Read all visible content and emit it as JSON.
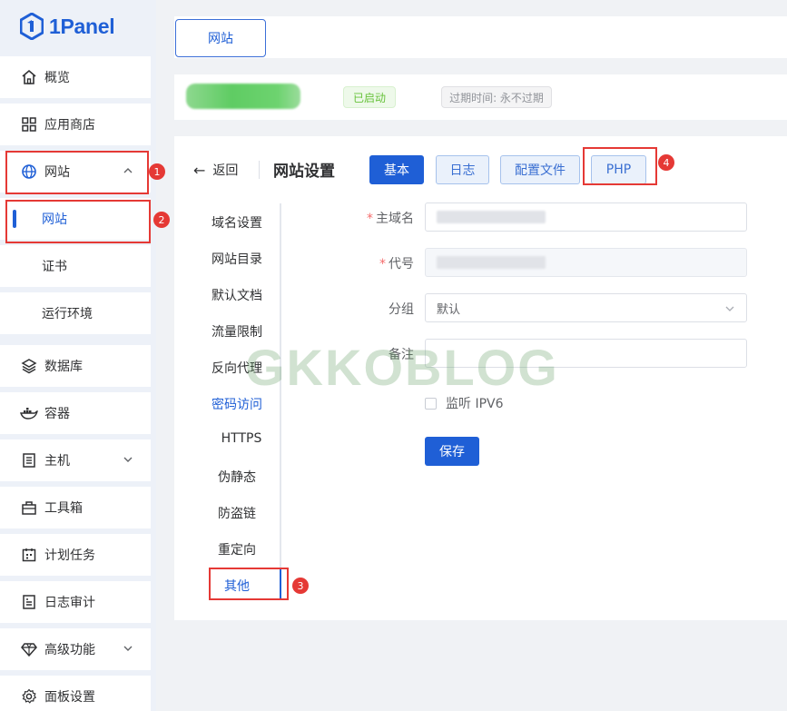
{
  "app": {
    "brand": "1Panel"
  },
  "sidebar": {
    "items": [
      {
        "label": "概览",
        "icon": "home-icon"
      },
      {
        "label": "应用商店",
        "icon": "grid-icon"
      },
      {
        "label": "网站",
        "icon": "globe-icon",
        "expanded": true
      },
      {
        "label": "网站",
        "sub": true,
        "active": true
      },
      {
        "label": "证书",
        "sub": true
      },
      {
        "label": "运行环境",
        "sub": true
      },
      {
        "label": "数据库",
        "icon": "layers-icon"
      },
      {
        "label": "容器",
        "icon": "docker-icon"
      },
      {
        "label": "主机",
        "icon": "server-icon",
        "has_caret": true
      },
      {
        "label": "工具箱",
        "icon": "toolbox-icon"
      },
      {
        "label": "计划任务",
        "icon": "calendar-icon"
      },
      {
        "label": "日志审计",
        "icon": "log-icon"
      },
      {
        "label": "高级功能",
        "icon": "diamond-icon",
        "has_caret": true
      },
      {
        "label": "面板设置",
        "icon": "gear-icon"
      }
    ]
  },
  "header": {
    "tab_label": "网站"
  },
  "site_info": {
    "status": "已启动",
    "expiry": "过期时间: 永不过期"
  },
  "settings": {
    "back_label": "返回",
    "title": "网站设置",
    "tabs": [
      "基本",
      "日志",
      "配置文件",
      "PHP"
    ],
    "active_tab": "基本",
    "menu": [
      "域名设置",
      "网站目录",
      "默认文档",
      "流量限制",
      "反向代理",
      "密码访问",
      "HTTPS",
      "伪静态",
      "防盗链",
      "重定向",
      "其他"
    ],
    "active_menu": "其他",
    "form": {
      "primary_domain_label": "主域名",
      "code_label": "代号",
      "group_label": "分组",
      "group_value": "默认",
      "remark_label": "备注",
      "ipv6_label": "监听 IPV6",
      "save_label": "保存"
    }
  },
  "watermark": "GKKOBLOG",
  "annotations": [
    "1",
    "2",
    "3",
    "4"
  ],
  "colors": {
    "accent": "#1f5fd6",
    "success": "#67c23a",
    "highlight": "#e53935",
    "required": "#f56c6c"
  }
}
